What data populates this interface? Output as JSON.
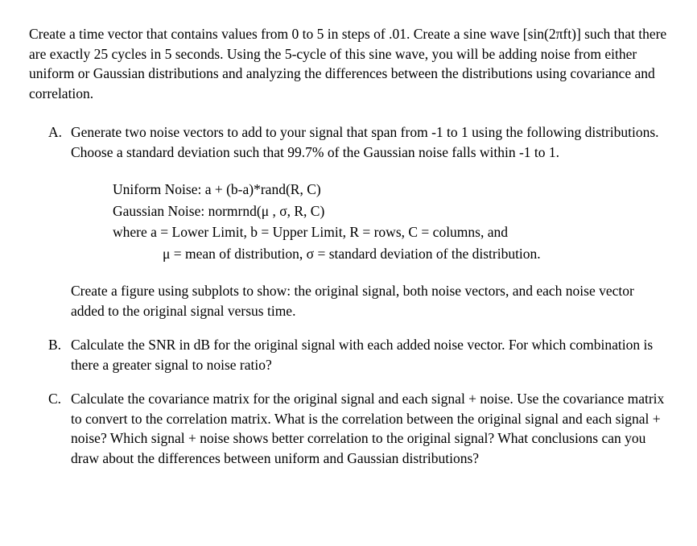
{
  "intro": "Create a time vector that contains values from 0 to 5 in steps of .01. Create a sine wave [sin(2πft)] such that there are exactly 25 cycles in 5 seconds. Using the 5-cycle of this sine wave, you will be adding noise from either uniform or Gaussian distributions and analyzing the differences between the distributions using covariance and correlation.",
  "items": {
    "a": {
      "label": "A.",
      "text1": "Generate two noise vectors to add to your signal that span from -1 to 1 using the following distributions. Choose a standard deviation such that 99.7% of the Gaussian noise falls within -1 to 1.",
      "noise": {
        "uniform": "Uniform Noise: a + (b-a)*rand(R, C)",
        "gaussian": "Gaussian Noise: normrnd(μ , σ, R, C)",
        "where": "where a = Lower Limit, b = Upper Limit, R = rows, C = columns, and",
        "where2": "μ = mean of distribution, σ = standard deviation of the distribution."
      },
      "text2": "Create a figure using subplots to show: the original signal, both noise vectors, and each noise vector added to the original signal versus time."
    },
    "b": {
      "label": "B.",
      "text": "Calculate the SNR in dB for the original signal with each added noise vector. For which combination is there a greater signal to noise ratio?"
    },
    "c": {
      "label": "C.",
      "text": "Calculate the covariance matrix for the original signal and each signal + noise. Use the covariance matrix to convert to the correlation matrix. What is the correlation between the original signal and each signal + noise? Which signal + noise shows better correlation to the original signal? What conclusions can you draw about the differences between uniform and Gaussian distributions?"
    }
  }
}
